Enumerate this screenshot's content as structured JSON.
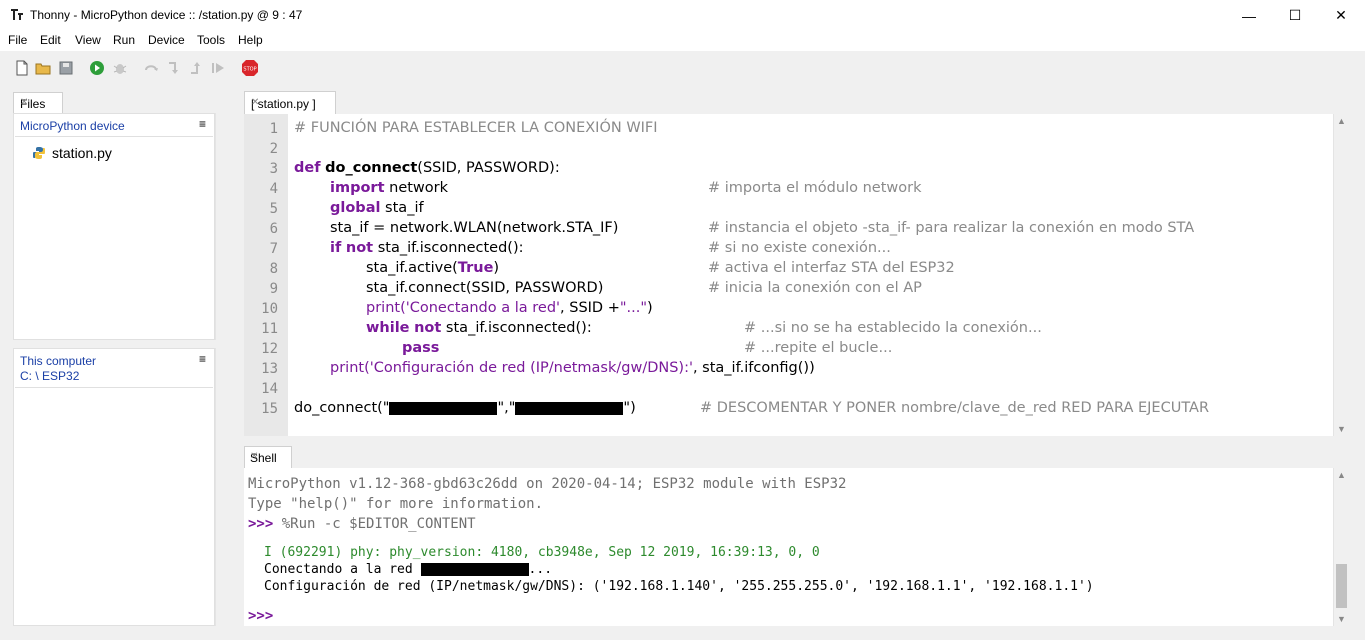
{
  "window": {
    "title": "Thonny  -  MicroPython device :: /station.py  @  9 : 47",
    "minimize": "—",
    "maximize": "☐",
    "close": "✕"
  },
  "menu": [
    "File",
    "Edit",
    "View",
    "Run",
    "Device",
    "Tools",
    "Help"
  ],
  "toolbar": {
    "icons": [
      "new-file-icon",
      "open-file-icon",
      "save-icon",
      "run-icon",
      "debug-icon",
      "step-over-icon",
      "step-into-icon",
      "step-out-icon",
      "resume-icon",
      "stop-icon"
    ],
    "stop_label": "STOP"
  },
  "files_panel": {
    "tab_label": "Files",
    "device_title": "MicroPython device",
    "device_files": [
      "station.py"
    ],
    "computer_title": "This computer",
    "computer_path": "C: \\ ESP32",
    "menu_glyph": "≡"
  },
  "editor": {
    "tab_label": "[ station.py ]",
    "line_numbers": [
      "1",
      "2",
      "3",
      "4",
      "5",
      "6",
      "7",
      "8",
      "9",
      "10",
      "11",
      "12",
      "13",
      "14",
      "15"
    ],
    "lines": {
      "l1": "# FUNCIÓN PARA ESTABLECER LA CONEXIÓN WIFI",
      "l3_kw": "def",
      "l3_fn": "do_connect",
      "l3_rest": "(SSID, PASSWORD):",
      "l4_kw": "import",
      "l4_rest": " network",
      "l4_cmt": "# importa el módulo network",
      "l5_kw": "global",
      "l5_rest": " sta_if",
      "l6_code": "sta_if = network.WLAN(network.STA_IF)",
      "l6_cmt": "# instancia el objeto -sta_if- para realizar la conexión en modo STA",
      "l7_kw1": "if",
      "l7_kw2": "not",
      "l7_rest": " sta_if.isconnected():",
      "l7_cmt": "# si no existe conexión...",
      "l8_code": "sta_if.active(",
      "l8_kw": "True",
      "l8_close": ")",
      "l8_cmt": "# activa el interfaz STA del ESP32",
      "l9_code": "sta_if.connect(SSID, PASSWORD)",
      "l9_cmt": "# inicia la conexión con el AP",
      "l10_print": "print(",
      "l10_str": "'Conectando a la red'",
      "l10_mid": ", SSID +",
      "l10_str2": "\"...\"",
      "l10_close": ")",
      "l11_kw1": "while",
      "l11_kw2": "not",
      "l11_rest": " sta_if.isconnected():",
      "l11_cmt": "# ...si no se ha establecido la conexión...",
      "l12_kw": "pass",
      "l12_cmt": "# ...repite el bucle...",
      "l13_print": "print(",
      "l13_str": "'Configuración de red (IP/netmask/gw/DNS):'",
      "l13_rest": ", sta_if.ifconfig())",
      "l15_a": "do_connect(\"",
      "l15_b": "\",\"",
      "l15_c": "\")",
      "l15_cmt": "# DESCOMENTAR Y PONER nombre/clave_de_red RED PARA EJECUTAR"
    }
  },
  "shell": {
    "tab_label": "Shell",
    "banner1": "MicroPython v1.12-368-gbd63c26dd on 2020-04-14; ESP32 module with ESP32",
    "banner2": "Type \"help()\" for more information.",
    "prompt": ">>>",
    "run_cmd": " %Run -c $EDITOR_CONTENT",
    "log": "I (692291) phy: phy_version: 4180, cb3948e, Sep 12 2019, 16:39:13, 0, 0",
    "out1a": "Conectando a la red ",
    "out1b": "...",
    "out2": "Configuración de red (IP/netmask/gw/DNS): ('192.168.1.140', '255.255.255.0', '192.168.1.1', '192.168.1.1')"
  }
}
